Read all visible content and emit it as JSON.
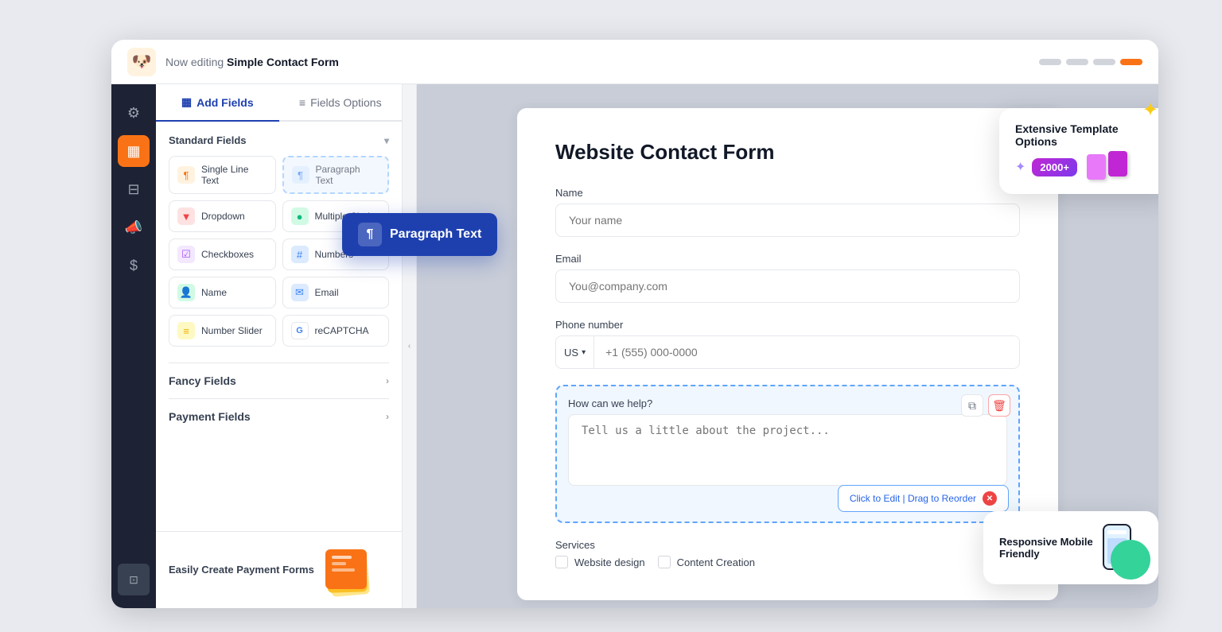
{
  "topbar": {
    "logo_emoji": "🐶",
    "editing_prefix": "Now editing ",
    "form_name": "Simple Contact Form"
  },
  "tabs": {
    "add_fields": "Add Fields",
    "fields_options": "Fields Options"
  },
  "standard_fields": {
    "label": "Standard Fields",
    "items": [
      {
        "id": "single-line-text",
        "icon": "¶",
        "icon_class": "icon-orange",
        "label": "Single Line Text"
      },
      {
        "id": "paragraph-text",
        "icon": "¶",
        "icon_class": "icon-blue",
        "label": "Paragraph Text"
      },
      {
        "id": "dropdown",
        "icon": "▼",
        "icon_class": "icon-red",
        "label": "Dropdown"
      },
      {
        "id": "multiple-choice",
        "icon": "●",
        "icon_class": "icon-green",
        "label": "Multiple Choice"
      },
      {
        "id": "checkboxes",
        "icon": "☑",
        "icon_class": "icon-purple",
        "label": "Checkboxes"
      },
      {
        "id": "numbers",
        "icon": "#",
        "icon_class": "icon-blue",
        "label": "Numbers"
      },
      {
        "id": "name",
        "icon": "👤",
        "icon_class": "icon-teal",
        "label": "Name"
      },
      {
        "id": "email",
        "icon": "✉",
        "icon_class": "icon-blue",
        "label": "Email"
      },
      {
        "id": "number-slider",
        "icon": "≡",
        "icon_class": "icon-yellow",
        "label": "Number Slider"
      },
      {
        "id": "recaptcha",
        "icon": "G",
        "icon_class": "icon-google",
        "label": "reCAPTCHA"
      }
    ]
  },
  "fancy_fields": {
    "label": "Fancy Fields"
  },
  "payment_fields": {
    "label": "Payment Fields"
  },
  "promo": {
    "text": "Easily Create Payment Forms"
  },
  "drag_tooltip": {
    "label": "Paragraph Text"
  },
  "form": {
    "title": "Website Contact Form",
    "fields": [
      {
        "id": "name",
        "label": "Name",
        "placeholder": "Your name",
        "type": "text"
      },
      {
        "id": "email",
        "label": "Email",
        "placeholder": "You@company.com",
        "type": "text"
      },
      {
        "id": "phone",
        "label": "Phone number",
        "country": "US",
        "placeholder": "+1 (555) 000-0000",
        "type": "phone"
      },
      {
        "id": "message",
        "label": "How can we help?",
        "placeholder": "Tell us a little about the project...",
        "type": "textarea",
        "selected": true
      }
    ],
    "services_label": "Services",
    "services": [
      "Website design",
      "Content Creation"
    ],
    "edit_bar_text": "Click to Edit | Drag to Reorder"
  },
  "template_promo": {
    "title": "Extensive Template Options",
    "badge": "2000+"
  },
  "mobile_promo": {
    "title": "Responsive Mobile Friendly"
  },
  "collapse_handle": "‹"
}
